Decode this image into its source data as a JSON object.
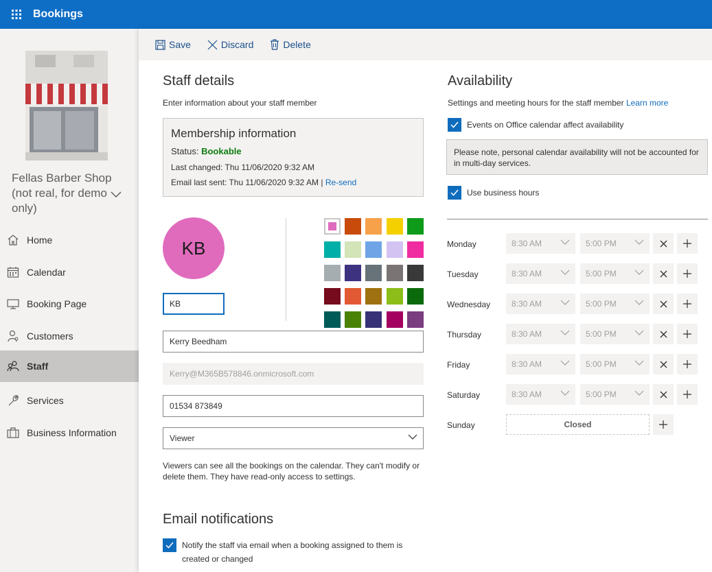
{
  "app": {
    "title": "Bookings"
  },
  "sidebar": {
    "shop_name": "Fellas Barber Shop (not real, for demo only)",
    "items": [
      {
        "label": "Home",
        "icon": "home-icon"
      },
      {
        "label": "Calendar",
        "icon": "calendar-icon"
      },
      {
        "label": "Booking Page",
        "icon": "monitor-icon"
      },
      {
        "label": "Customers",
        "icon": "person-icon"
      },
      {
        "label": "Staff",
        "icon": "people-icon",
        "active": true
      },
      {
        "label": "Services",
        "icon": "wrench-icon"
      },
      {
        "label": "Business Information",
        "icon": "briefcase-icon"
      }
    ]
  },
  "toolbar": {
    "save": "Save",
    "discard": "Discard",
    "delete": "Delete"
  },
  "staff": {
    "title": "Staff details",
    "subtitle": "Enter information about your staff member",
    "membership": {
      "title": "Membership information",
      "status_label": "Status:",
      "status_value": "Bookable",
      "last_changed": "Last changed: Thu 11/06/2020 9:32 AM",
      "email_last_sent": "Email last sent: Thu 11/06/2020 9:32 AM |",
      "resend": "Re-send"
    },
    "avatar_initials": "KB",
    "initials_value": "KB",
    "name_value": "Kerry  Beedham",
    "email_value": "Kerry@M365B578846.onmicrosoft.com",
    "phone_value": "01534 873849",
    "role_value": "Viewer",
    "role_note": "Viewers can see all the bookings on the calendar. They can't modify or delete them. They have read-only access to settings.",
    "colors": [
      "#e06bbd",
      "#c84b0c",
      "#f7a14b",
      "#f4d000",
      "#0e9b1a",
      "#00b0a8",
      "#d3e4b8",
      "#6fa5e6",
      "#d3c3f2",
      "#f02ca1",
      "#a5adb1",
      "#3c3280",
      "#677378",
      "#7a7574",
      "#393939",
      "#750b1c",
      "#e25a34",
      "#a07110",
      "#8cbd18",
      "#0b6a0b",
      "#005b58",
      "#498205",
      "#373277",
      "#a30060",
      "#7a3d80"
    ]
  },
  "email_notifications": {
    "title": "Email notifications",
    "notify_label": "Notify the staff via email when a booking assigned to them is created or changed"
  },
  "availability": {
    "title": "Availability",
    "subtitle": "Settings and meeting hours for the staff member",
    "learn_more": "Learn more",
    "office_calendar_label": "Events on Office calendar affect availability",
    "info_note": "Please note, personal calendar availability will not be accounted for in multi-day services.",
    "business_hours_label": "Use business hours",
    "days": [
      {
        "day": "Monday",
        "start": "8:30 AM",
        "end": "5:00 PM"
      },
      {
        "day": "Tuesday",
        "start": "8:30 AM",
        "end": "5:00 PM"
      },
      {
        "day": "Wednesday",
        "start": "8:30 AM",
        "end": "5:00 PM"
      },
      {
        "day": "Thursday",
        "start": "8:30 AM",
        "end": "5:00 PM"
      },
      {
        "day": "Friday",
        "start": "8:30 AM",
        "end": "5:00 PM"
      },
      {
        "day": "Saturday",
        "start": "8:30 AM",
        "end": "5:00 PM"
      }
    ],
    "sunday": {
      "day": "Sunday",
      "status": "Closed"
    }
  }
}
